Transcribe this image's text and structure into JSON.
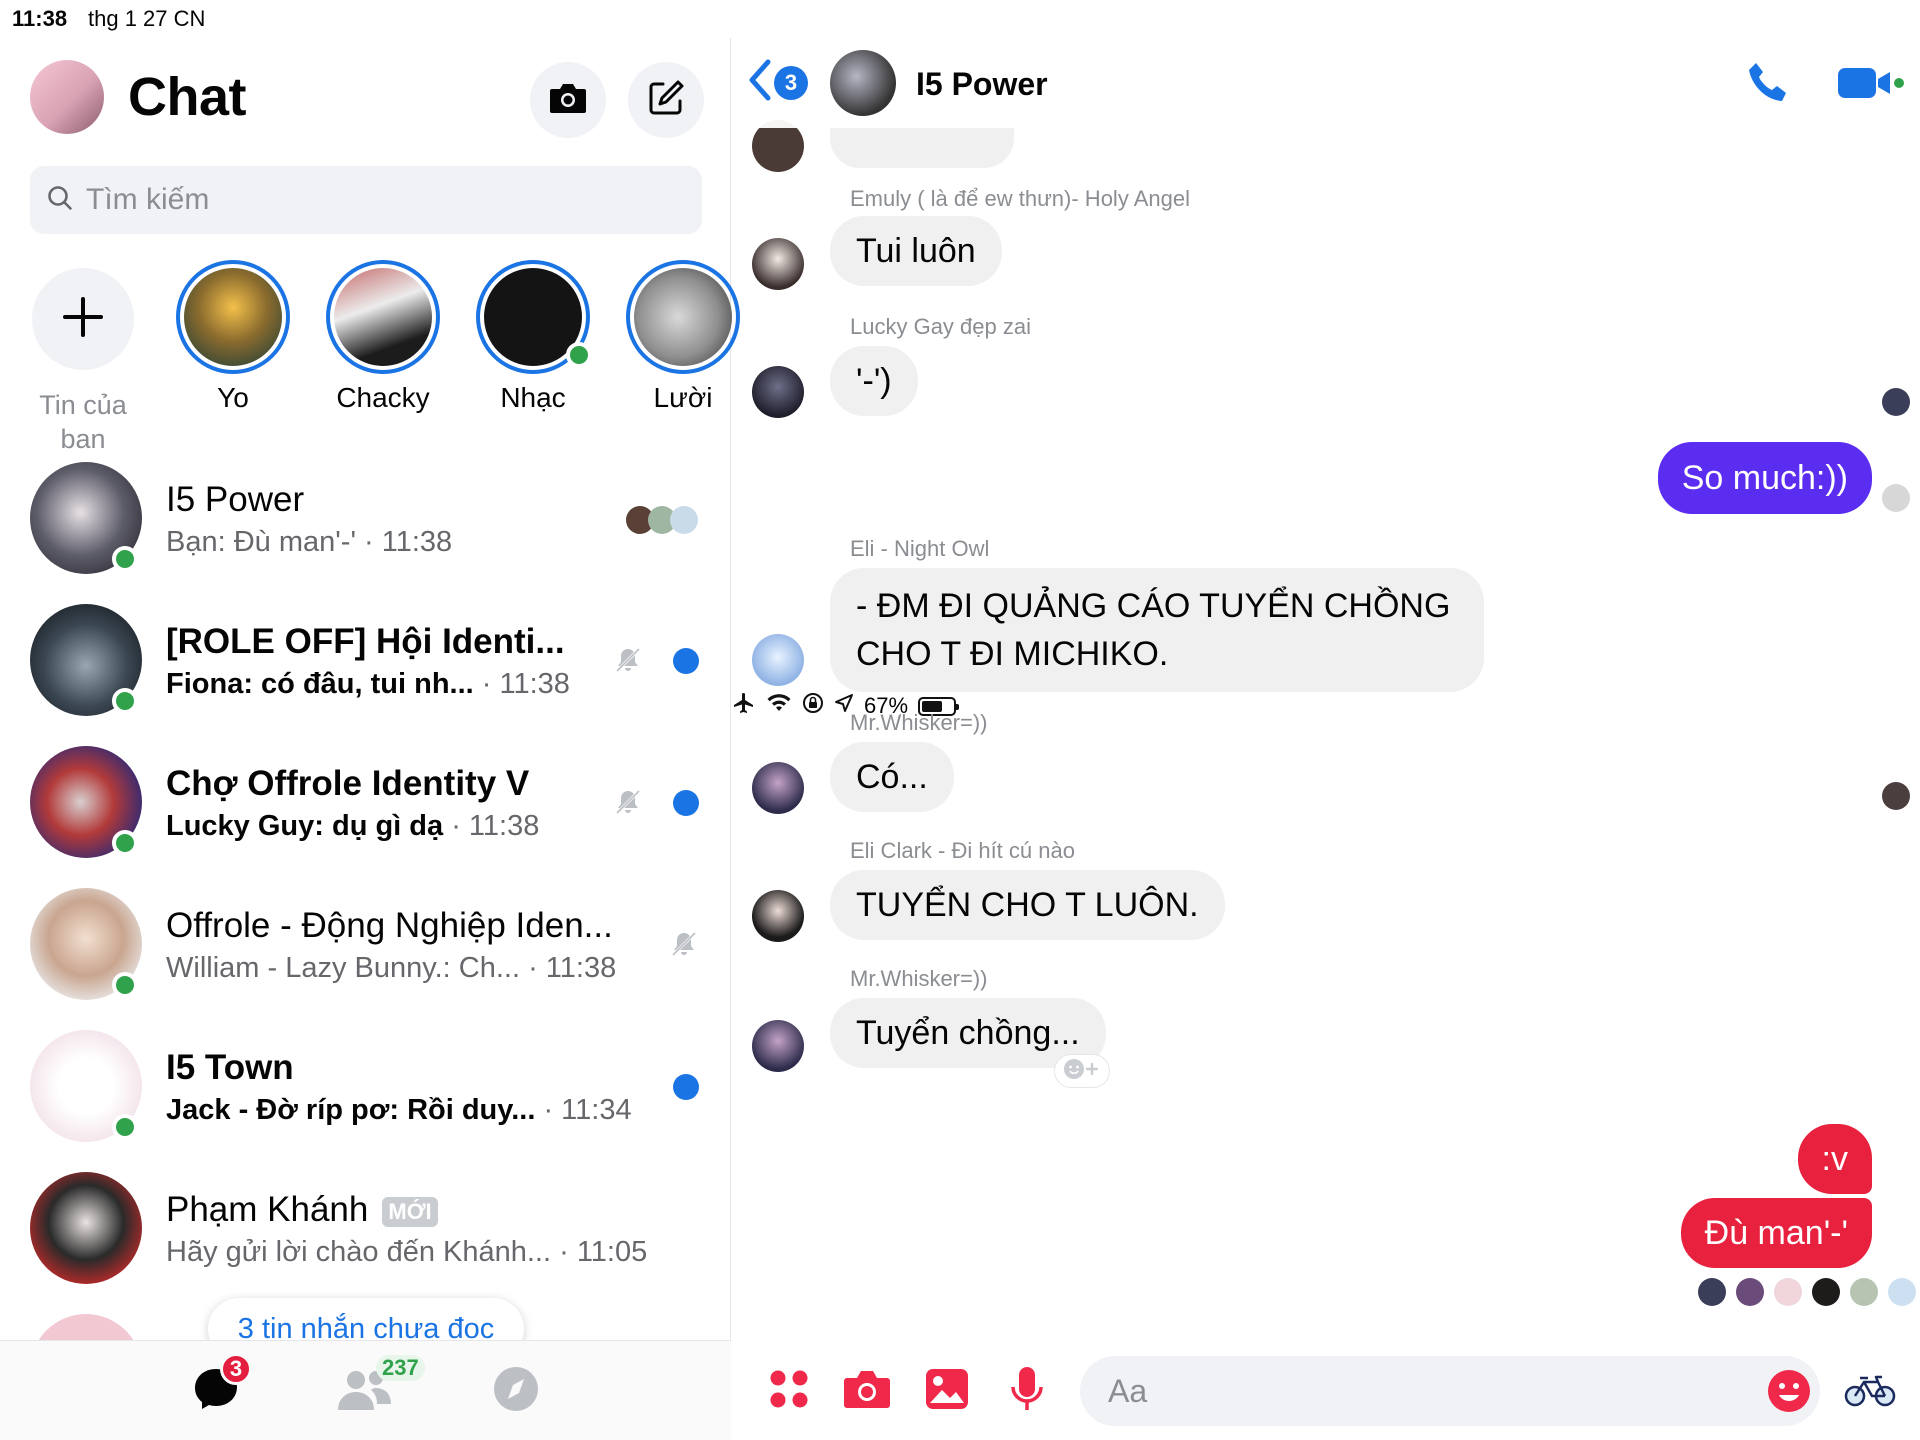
{
  "status_bar": {
    "time": "11:38",
    "date": "thg 1 27 CN",
    "battery": "67%",
    "battery_level": 0.67
  },
  "left": {
    "title": "Chat",
    "search": {
      "placeholder": "Tìm kiếm"
    },
    "stories": [
      {
        "label": "Tin của\nban",
        "type": "add"
      },
      {
        "label": "Yo"
      },
      {
        "label": "Chacky"
      },
      {
        "label": "Nhạc"
      },
      {
        "label": "Lười"
      }
    ],
    "conversations": [
      {
        "name": "I5 Power",
        "preview": "Bạn: Đù man'-' ",
        "time": "· 11:38",
        "unread": false
      },
      {
        "name": "[ROLE OFF]  Hội Identi...",
        "preview": "Fiona: có đâu, tui nh... ",
        "time": "· 11:38",
        "unread": true,
        "muted": true
      },
      {
        "name": "Chợ Offrole Identity V",
        "preview": "Lucky Guy: dụ gì dạ ",
        "time": "· 11:38",
        "unread": true,
        "muted": true
      },
      {
        "name": "Offrole - Động Nghiệp Iden...",
        "preview": "William - Lazy Bunny.: Ch... ",
        "time": "· 11:38",
        "unread": false,
        "muted": true
      },
      {
        "name": "I5 Town",
        "preview": "Jack - Đờ ríp pơ: Rồi duy... ",
        "time": "· 11:34",
        "unread": true
      },
      {
        "name": "Phạm Khánh",
        "badge": "MỚI",
        "preview": "Hãy gửi lời chào đến Khánh... ",
        "time": "· 11:05",
        "unread": false
      }
    ],
    "unread_pill": "3 tin nhắn chưa đọc",
    "tabs": {
      "chats_badge": "3",
      "people_badge": "237"
    }
  },
  "chat": {
    "name": "I5 Power",
    "back_badge": "3",
    "messages": [
      {
        "sender": "Emuly ( là để ew thưn)- Holy Angel",
        "text": "Tui luôn"
      },
      {
        "sender": "Lucky Gay đẹp zai",
        "text": "'-')"
      },
      {
        "from_me": true,
        "text": "So much:))"
      },
      {
        "sender": "Eli - Night Owl",
        "text": "- ĐM ĐI QUẢNG CÁO TUYỂN CHỒNG CHO T ĐI MICHIKO."
      },
      {
        "sender": "Mr.Whisker=))",
        "text": "Có..."
      },
      {
        "sender": "Eli Clark - Đi hít cú nào",
        "text": "TUYỂN CHO T LUÔN."
      },
      {
        "sender": "Mr.Whisker=))",
        "text": "Tuyển chồng..."
      },
      {
        "from_me": true,
        "text": ":v"
      },
      {
        "from_me": true,
        "text": "Đù man'-'"
      }
    ],
    "input_placeholder": "Aa"
  },
  "colors": {
    "accent": "#1b74e4",
    "out_purple": "#5b2df0",
    "out_red": "#e8213f",
    "online": "#31a24c"
  }
}
